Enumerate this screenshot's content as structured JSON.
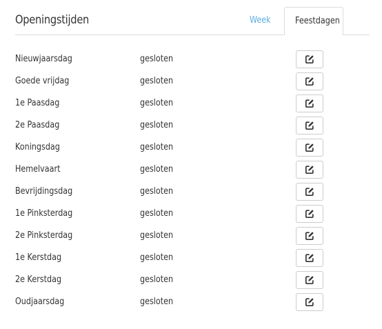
{
  "header": {
    "title": "Openingstijden",
    "tabs": {
      "week": "Week",
      "feestdagen": "Feestdagen"
    },
    "active_tab": "Feestdagen",
    "accent_color": "#5dade2"
  },
  "holidays": [
    {
      "name": "Nieuwjaarsdag",
      "status": "gesloten"
    },
    {
      "name": "Goede vrijdag",
      "status": "gesloten"
    },
    {
      "name": "1e Paasdag",
      "status": "gesloten"
    },
    {
      "name": "2e Paasdag",
      "status": "gesloten"
    },
    {
      "name": "Koningsdag",
      "status": "gesloten"
    },
    {
      "name": "Hemelvaart",
      "status": "gesloten"
    },
    {
      "name": "Bevrijdingsdag",
      "status": "gesloten"
    },
    {
      "name": "1e Pinksterdag",
      "status": "gesloten"
    },
    {
      "name": "2e Pinksterdag",
      "status": "gesloten"
    },
    {
      "name": "1e Kerstdag",
      "status": "gesloten"
    },
    {
      "name": "2e Kerstdag",
      "status": "gesloten"
    },
    {
      "name": "Oudjaarsdag",
      "status": "gesloten"
    }
  ],
  "row_action_icon": "edit-icon"
}
